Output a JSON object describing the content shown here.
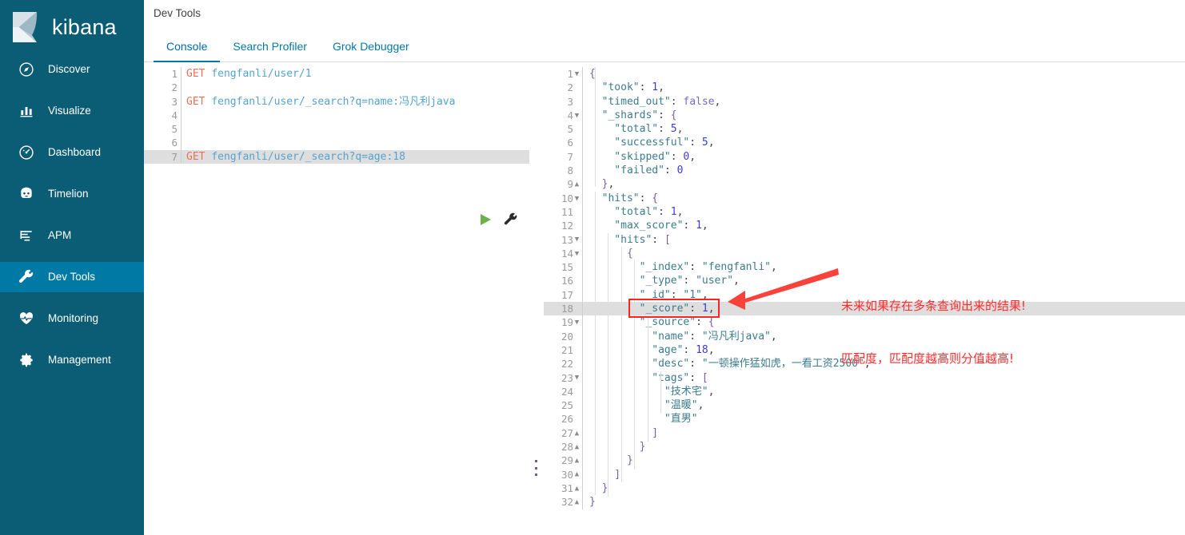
{
  "sidebar": {
    "brand": "kibana",
    "items": [
      {
        "label": "Discover",
        "icon": "compass-icon",
        "active": false
      },
      {
        "label": "Visualize",
        "icon": "bar-chart-icon",
        "active": false
      },
      {
        "label": "Dashboard",
        "icon": "dashboard-icon",
        "active": false
      },
      {
        "label": "Timelion",
        "icon": "timelion-icon",
        "active": false
      },
      {
        "label": "APM",
        "icon": "apm-icon",
        "active": false
      },
      {
        "label": "Dev Tools",
        "icon": "wrench-icon",
        "active": true
      },
      {
        "label": "Monitoring",
        "icon": "heartbeat-icon",
        "active": false
      },
      {
        "label": "Management",
        "icon": "gear-icon",
        "active": false
      }
    ]
  },
  "header": {
    "title": "Dev Tools",
    "tabs": [
      {
        "label": "Console",
        "active": true
      },
      {
        "label": "Search Profiler",
        "active": false
      },
      {
        "label": "Grok Debugger",
        "active": false
      }
    ]
  },
  "console": {
    "request": {
      "run_icon": "play-icon",
      "wrench_icon": "wrench-icon",
      "highlighted_line": 7,
      "lines": [
        {
          "n": 1,
          "fold": "",
          "tokens": [
            {
              "t": "GET",
              "c": "k-method"
            },
            {
              "t": " ",
              "c": "k-punc"
            },
            {
              "t": "fengfanli/user/1",
              "c": "k-url"
            }
          ]
        },
        {
          "n": 2,
          "fold": "",
          "tokens": []
        },
        {
          "n": 3,
          "fold": "",
          "tokens": [
            {
              "t": "GET",
              "c": "k-method"
            },
            {
              "t": " ",
              "c": "k-punc"
            },
            {
              "t": "fengfanli/user/_search?q=name:冯凡利java",
              "c": "k-url"
            }
          ]
        },
        {
          "n": 4,
          "fold": "",
          "tokens": []
        },
        {
          "n": 5,
          "fold": "",
          "tokens": []
        },
        {
          "n": 6,
          "fold": "",
          "tokens": []
        },
        {
          "n": 7,
          "fold": "",
          "tokens": [
            {
              "t": "GET",
              "c": "k-method"
            },
            {
              "t": " ",
              "c": "k-punc"
            },
            {
              "t": "fengfanli/user/_search?q=age:18",
              "c": "k-url"
            }
          ]
        }
      ]
    },
    "response": {
      "highlighted_line": 18,
      "lines": [
        {
          "n": 1,
          "fold": "open",
          "tokens": [
            {
              "t": "{",
              "c": "k-brace"
            }
          ]
        },
        {
          "n": 2,
          "fold": "",
          "tokens": [
            {
              "t": "  \"took\"",
              "c": "k-key"
            },
            {
              "t": ": ",
              "c": "k-punc"
            },
            {
              "t": "1",
              "c": "k-num"
            },
            {
              "t": ",",
              "c": "k-punc"
            }
          ]
        },
        {
          "n": 3,
          "fold": "",
          "tokens": [
            {
              "t": "  \"timed_out\"",
              "c": "k-key"
            },
            {
              "t": ": ",
              "c": "k-punc"
            },
            {
              "t": "false",
              "c": "k-bool"
            },
            {
              "t": ",",
              "c": "k-punc"
            }
          ]
        },
        {
          "n": 4,
          "fold": "open",
          "tokens": [
            {
              "t": "  \"_shards\"",
              "c": "k-key"
            },
            {
              "t": ": ",
              "c": "k-punc"
            },
            {
              "t": "{",
              "c": "k-brace"
            }
          ]
        },
        {
          "n": 5,
          "fold": "",
          "tokens": [
            {
              "t": "    \"total\"",
              "c": "k-key"
            },
            {
              "t": ": ",
              "c": "k-punc"
            },
            {
              "t": "5",
              "c": "k-num"
            },
            {
              "t": ",",
              "c": "k-punc"
            }
          ]
        },
        {
          "n": 6,
          "fold": "",
          "tokens": [
            {
              "t": "    \"successful\"",
              "c": "k-key"
            },
            {
              "t": ": ",
              "c": "k-punc"
            },
            {
              "t": "5",
              "c": "k-num"
            },
            {
              "t": ",",
              "c": "k-punc"
            }
          ]
        },
        {
          "n": 7,
          "fold": "",
          "tokens": [
            {
              "t": "    \"skipped\"",
              "c": "k-key"
            },
            {
              "t": ": ",
              "c": "k-punc"
            },
            {
              "t": "0",
              "c": "k-num"
            },
            {
              "t": ",",
              "c": "k-punc"
            }
          ]
        },
        {
          "n": 8,
          "fold": "",
          "tokens": [
            {
              "t": "    \"failed\"",
              "c": "k-key"
            },
            {
              "t": ": ",
              "c": "k-punc"
            },
            {
              "t": "0",
              "c": "k-num"
            }
          ]
        },
        {
          "n": 9,
          "fold": "close",
          "tokens": [
            {
              "t": "  }",
              "c": "k-brace"
            },
            {
              "t": ",",
              "c": "k-punc"
            }
          ]
        },
        {
          "n": 10,
          "fold": "open",
          "tokens": [
            {
              "t": "  \"hits\"",
              "c": "k-key"
            },
            {
              "t": ": ",
              "c": "k-punc"
            },
            {
              "t": "{",
              "c": "k-brace"
            }
          ]
        },
        {
          "n": 11,
          "fold": "",
          "tokens": [
            {
              "t": "    \"total\"",
              "c": "k-key"
            },
            {
              "t": ": ",
              "c": "k-punc"
            },
            {
              "t": "1",
              "c": "k-num"
            },
            {
              "t": ",",
              "c": "k-punc"
            }
          ]
        },
        {
          "n": 12,
          "fold": "",
          "tokens": [
            {
              "t": "    \"max_score\"",
              "c": "k-key"
            },
            {
              "t": ": ",
              "c": "k-punc"
            },
            {
              "t": "1",
              "c": "k-num"
            },
            {
              "t": ",",
              "c": "k-punc"
            }
          ]
        },
        {
          "n": 13,
          "fold": "open",
          "tokens": [
            {
              "t": "    \"hits\"",
              "c": "k-key"
            },
            {
              "t": ": ",
              "c": "k-punc"
            },
            {
              "t": "[",
              "c": "k-brace"
            }
          ]
        },
        {
          "n": 14,
          "fold": "open",
          "tokens": [
            {
              "t": "      {",
              "c": "k-brace"
            }
          ]
        },
        {
          "n": 15,
          "fold": "",
          "tokens": [
            {
              "t": "        \"_index\"",
              "c": "k-key"
            },
            {
              "t": ": ",
              "c": "k-punc"
            },
            {
              "t": "\"fengfanli\"",
              "c": "k-str"
            },
            {
              "t": ",",
              "c": "k-punc"
            }
          ]
        },
        {
          "n": 16,
          "fold": "",
          "tokens": [
            {
              "t": "        \"_type\"",
              "c": "k-key"
            },
            {
              "t": ": ",
              "c": "k-punc"
            },
            {
              "t": "\"user\"",
              "c": "k-str"
            },
            {
              "t": ",",
              "c": "k-punc"
            }
          ]
        },
        {
          "n": 17,
          "fold": "",
          "tokens": [
            {
              "t": "        \"_id\"",
              "c": "k-key"
            },
            {
              "t": ": ",
              "c": "k-punc"
            },
            {
              "t": "\"1\"",
              "c": "k-str"
            },
            {
              "t": ",",
              "c": "k-punc"
            }
          ]
        },
        {
          "n": 18,
          "fold": "",
          "tokens": [
            {
              "t": "        \"_score\"",
              "c": "k-key"
            },
            {
              "t": ": ",
              "c": "k-punc"
            },
            {
              "t": "1",
              "c": "k-num"
            },
            {
              "t": ",",
              "c": "k-punc"
            }
          ]
        },
        {
          "n": 19,
          "fold": "open",
          "tokens": [
            {
              "t": "        \"_source\"",
              "c": "k-key"
            },
            {
              "t": ": ",
              "c": "k-punc"
            },
            {
              "t": "{",
              "c": "k-brace"
            }
          ]
        },
        {
          "n": 20,
          "fold": "",
          "tokens": [
            {
              "t": "          \"name\"",
              "c": "k-key"
            },
            {
              "t": ": ",
              "c": "k-punc"
            },
            {
              "t": "\"冯凡利java\"",
              "c": "k-str"
            },
            {
              "t": ",",
              "c": "k-punc"
            }
          ]
        },
        {
          "n": 21,
          "fold": "",
          "tokens": [
            {
              "t": "          \"age\"",
              "c": "k-key"
            },
            {
              "t": ": ",
              "c": "k-punc"
            },
            {
              "t": "18",
              "c": "k-num"
            },
            {
              "t": ",",
              "c": "k-punc"
            }
          ]
        },
        {
          "n": 22,
          "fold": "",
          "tokens": [
            {
              "t": "          \"desc\"",
              "c": "k-key"
            },
            {
              "t": ": ",
              "c": "k-punc"
            },
            {
              "t": "\"一顿操作猛如虎，一看工资2500\"",
              "c": "k-str"
            },
            {
              "t": ",",
              "c": "k-punc"
            }
          ]
        },
        {
          "n": 23,
          "fold": "open",
          "tokens": [
            {
              "t": "          \"tags\"",
              "c": "k-key"
            },
            {
              "t": ": ",
              "c": "k-punc"
            },
            {
              "t": "[",
              "c": "k-brace"
            }
          ]
        },
        {
          "n": 24,
          "fold": "",
          "tokens": [
            {
              "t": "            \"技术宅\"",
              "c": "k-str"
            },
            {
              "t": ",",
              "c": "k-punc"
            }
          ]
        },
        {
          "n": 25,
          "fold": "",
          "tokens": [
            {
              "t": "            \"温暖\"",
              "c": "k-str"
            },
            {
              "t": ",",
              "c": "k-punc"
            }
          ]
        },
        {
          "n": 26,
          "fold": "",
          "tokens": [
            {
              "t": "            \"直男\"",
              "c": "k-str"
            }
          ]
        },
        {
          "n": 27,
          "fold": "close",
          "tokens": [
            {
              "t": "          ]",
              "c": "k-brace"
            }
          ]
        },
        {
          "n": 28,
          "fold": "close",
          "tokens": [
            {
              "t": "        }",
              "c": "k-brace"
            }
          ]
        },
        {
          "n": 29,
          "fold": "close",
          "tokens": [
            {
              "t": "      }",
              "c": "k-brace"
            }
          ]
        },
        {
          "n": 30,
          "fold": "close",
          "tokens": [
            {
              "t": "    ]",
              "c": "k-brace"
            }
          ]
        },
        {
          "n": 31,
          "fold": "close",
          "tokens": [
            {
              "t": "  }",
              "c": "k-brace"
            }
          ]
        },
        {
          "n": 32,
          "fold": "close",
          "tokens": [
            {
              "t": "}",
              "c": "k-brace"
            }
          ]
        }
      ]
    }
  },
  "annotation": {
    "line1": "未来如果存在多条查询出来的结果!",
    "line2": "匹配度，匹配度越高则分值越高!",
    "color": "#ff2d2d",
    "box_target": "\"_score\": 1,"
  },
  "colors": {
    "sidebar_bg": "#0b5d76",
    "sidebar_active": "#0079a5",
    "accent": "#0079a5",
    "annotation_red": "#ff2d2d",
    "highlight_row": "#dedede"
  }
}
